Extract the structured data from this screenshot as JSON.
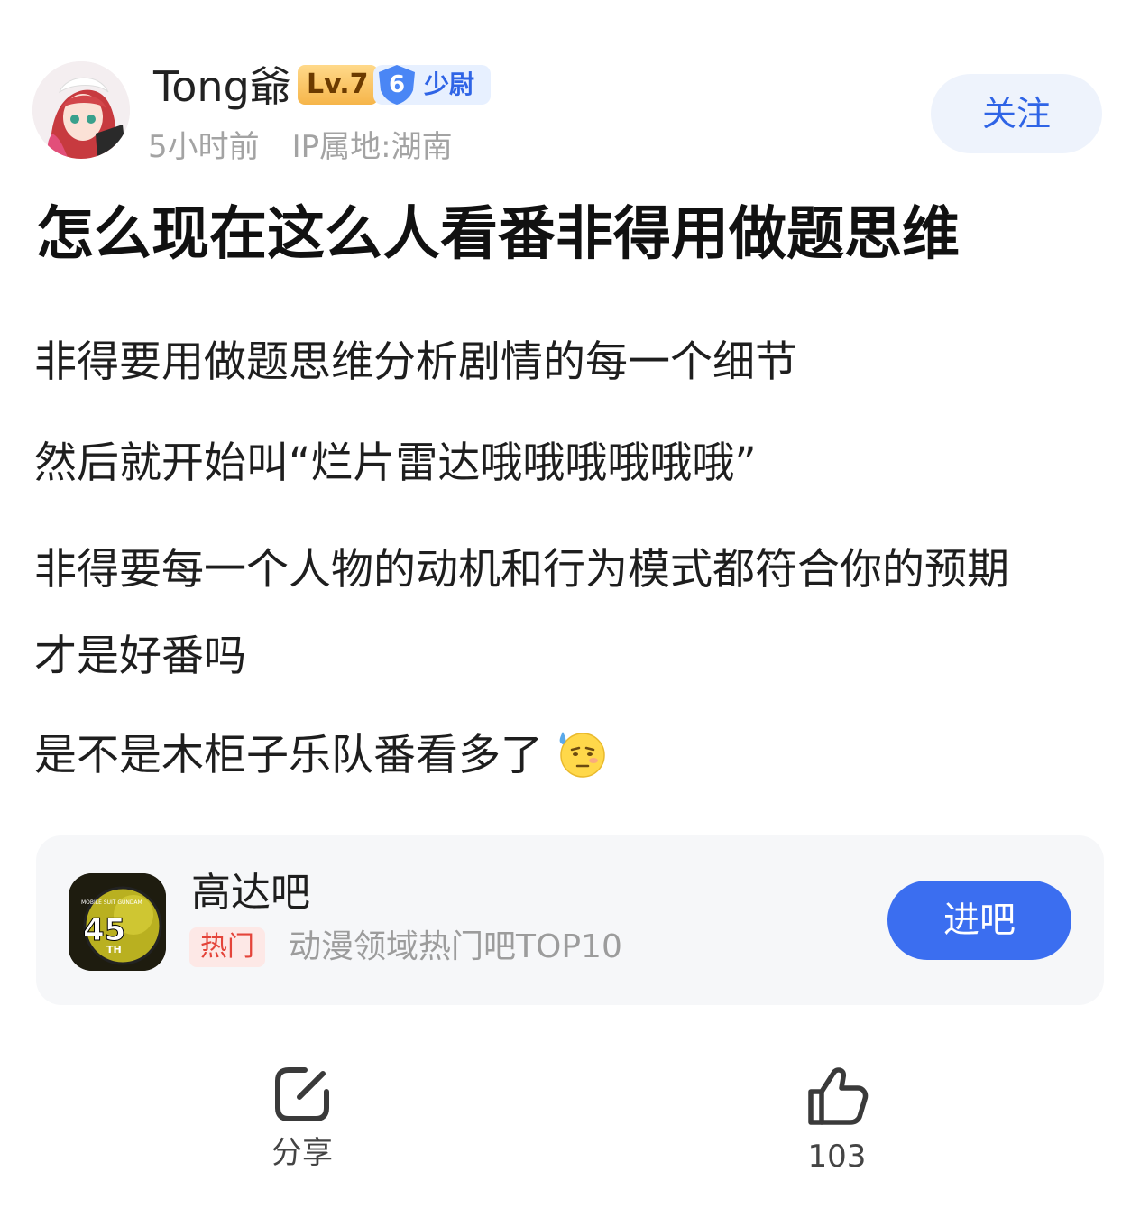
{
  "author": {
    "name": "Tong爺",
    "level_badge": "Lv.7",
    "rank_number": "6",
    "rank_title": "少尉",
    "time": "5小时前",
    "ip_location": "IP属地:湖南",
    "follow_label": "关注"
  },
  "post": {
    "title": "怎么现在这么人看番非得用做题思维",
    "paragraphs": [
      "非得要用做题思维分析剧情的每一个细节",
      "然后就开始叫“烂片雷达哦哦哦哦哦哦”",
      "非得要每一个人物的动机和行为模式都符合你的预期",
      "才是好番吗",
      "是不是木柜子乐队番看多了"
    ]
  },
  "forum": {
    "name": "高达吧",
    "hot_tag": "热门",
    "rank_text": "动漫领域热门吧TOP10",
    "enter_label": "进吧",
    "icon_text_top": "MOBILE SUIT GUNDAM",
    "icon_number": "45",
    "icon_suffix": "TH"
  },
  "actions": {
    "share_label": "分享",
    "like_count": "103"
  },
  "colors": {
    "accent": "#3b6ef0",
    "follow_text": "#2f64e6",
    "hot": "#e4443a"
  }
}
